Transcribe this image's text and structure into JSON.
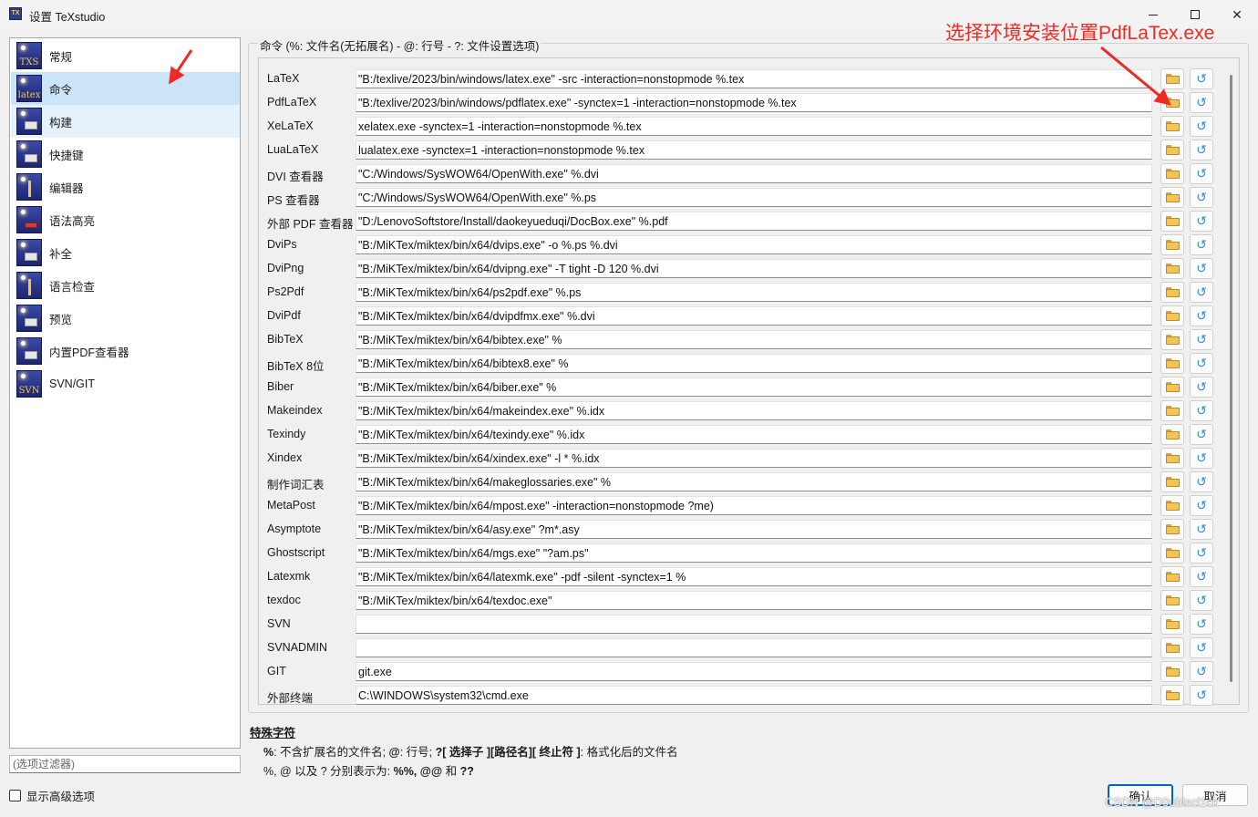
{
  "window": {
    "title": "设置 TeXstudio",
    "icon": "texstudio-app-icon"
  },
  "nav": {
    "items": [
      {
        "id": "general",
        "label": "常规",
        "icon": "txs-icon",
        "glyph": "TXS",
        "state": ""
      },
      {
        "id": "commands",
        "label": "命令",
        "icon": "latex-icon",
        "glyph": "latex",
        "state": "selected"
      },
      {
        "id": "build",
        "label": "构建",
        "icon": "build-icon",
        "glyph": "",
        "state": "hovered"
      },
      {
        "id": "shortcuts",
        "label": "快捷键",
        "icon": "keyboard-icon",
        "glyph": "",
        "state": ""
      },
      {
        "id": "editor",
        "label": "编辑器",
        "icon": "cursor-icon",
        "glyph": "",
        "state": ""
      },
      {
        "id": "syntax",
        "label": "语法高亮",
        "icon": "highlight-icon",
        "glyph": "",
        "state": ""
      },
      {
        "id": "completion",
        "label": "补全",
        "icon": "completion-icon",
        "glyph": "",
        "state": ""
      },
      {
        "id": "spell",
        "label": "语言检查",
        "icon": "spellcheck-icon",
        "glyph": "",
        "state": ""
      },
      {
        "id": "preview",
        "label": "预览",
        "icon": "preview-icon",
        "glyph": "",
        "state": ""
      },
      {
        "id": "pdfviewer",
        "label": "内置PDF查看器",
        "icon": "pdf-viewer-icon",
        "glyph": "",
        "state": ""
      },
      {
        "id": "svn",
        "label": "SVN/GIT",
        "icon": "svn-icon",
        "glyph": "SVN",
        "state": ""
      }
    ],
    "filter_placeholder": "(选项过滤器)",
    "advanced_label": "显示高级选项",
    "advanced_checked": false
  },
  "commands": {
    "group_title": "命令 (%: 文件名(无拓展名) - @: 行号 - ?: 文件设置选项)",
    "rows": [
      {
        "label": "LaTeX",
        "value": "\"B:/texlive/2023/bin/windows/latex.exe\" -src -interaction=nonstopmode %.tex"
      },
      {
        "label": "PdfLaTeX",
        "value": "\"B:/texlive/2023/bin/windows/pdflatex.exe\" -synctex=1 -interaction=nonstopmode %.tex"
      },
      {
        "label": "XeLaTeX",
        "value": "xelatex.exe -synctex=1 -interaction=nonstopmode %.tex"
      },
      {
        "label": "LuaLaTeX",
        "value": "lualatex.exe -synctex=1 -interaction=nonstopmode %.tex"
      },
      {
        "label": "DVI 查看器",
        "value": "\"C:/Windows/SysWOW64/OpenWith.exe\" %.dvi"
      },
      {
        "label": "PS 查看器",
        "value": "\"C:/Windows/SysWOW64/OpenWith.exe\" %.ps"
      },
      {
        "label": "外部 PDF 查看器",
        "value": "\"D:/LenovoSoftstore/Install/daokeyueduqi/DocBox.exe\" %.pdf"
      },
      {
        "label": "DviPs",
        "value": "\"B:/MiKTex/miktex/bin/x64/dvips.exe\" -o %.ps %.dvi"
      },
      {
        "label": "DviPng",
        "value": "\"B:/MiKTex/miktex/bin/x64/dvipng.exe\" -T tight -D 120 %.dvi"
      },
      {
        "label": "Ps2Pdf",
        "value": "\"B:/MiKTex/miktex/bin/x64/ps2pdf.exe\" %.ps"
      },
      {
        "label": "DviPdf",
        "value": "\"B:/MiKTex/miktex/bin/x64/dvipdfmx.exe\" %.dvi"
      },
      {
        "label": "BibTeX",
        "value": "\"B:/MiKTex/miktex/bin/x64/bibtex.exe\" %"
      },
      {
        "label": "BibTeX 8位",
        "value": "\"B:/MiKTex/miktex/bin/x64/bibtex8.exe\" %"
      },
      {
        "label": "Biber",
        "value": "\"B:/MiKTex/miktex/bin/x64/biber.exe\" %"
      },
      {
        "label": "Makeindex",
        "value": "\"B:/MiKTex/miktex/bin/x64/makeindex.exe\" %.idx"
      },
      {
        "label": "Texindy",
        "value": "\"B:/MiKTex/miktex/bin/x64/texindy.exe\" %.idx"
      },
      {
        "label": "Xindex",
        "value": "\"B:/MiKTex/miktex/bin/x64/xindex.exe\" -l * %.idx"
      },
      {
        "label": "制作词汇表",
        "value": "\"B:/MiKTex/miktex/bin/x64/makeglossaries.exe\" %"
      },
      {
        "label": "MetaPost",
        "value": "\"B:/MiKTex/miktex/bin/x64/mpost.exe\" -interaction=nonstopmode ?me)"
      },
      {
        "label": "Asymptote",
        "value": "\"B:/MiKTex/miktex/bin/x64/asy.exe\" ?m*.asy"
      },
      {
        "label": "Ghostscript",
        "value": "\"B:/MiKTex/miktex/bin/x64/mgs.exe\" \"?am.ps\""
      },
      {
        "label": "Latexmk",
        "value": "\"B:/MiKTex/miktex/bin/x64/latexmk.exe\" -pdf -silent -synctex=1 %"
      },
      {
        "label": "texdoc",
        "value": "\"B:/MiKTex/miktex/bin/x64/texdoc.exe\""
      },
      {
        "label": "SVN",
        "value": ""
      },
      {
        "label": "SVNADMIN",
        "value": ""
      },
      {
        "label": "GIT",
        "value": "git.exe"
      },
      {
        "label": "外部终端",
        "value": "C:\\WINDOWS\\system32\\cmd.exe"
      }
    ],
    "folder_icon": "folder-icon",
    "reset_icon": "reset-icon",
    "reset_glyph": "↺"
  },
  "special": {
    "title": "特殊字符",
    "line1": {
      "p1b": "%",
      "p1": ": 不含扩展名的文件名;  ",
      "p2b": "@",
      "p2": ": 行号;  ",
      "p3b": "?[ 选择子 ][路径名][ 终止符 ]",
      "p3": ": 格式化后的文件名"
    },
    "line2": {
      "p1": "%, @ 以及 ? 分别表示为: ",
      "p2b": "%%, @@",
      "p3": " 和 ",
      "p4b": "??"
    }
  },
  "buttons": {
    "ok": "确认",
    "cancel": "取消"
  },
  "annotation": {
    "text": "选择环境安装位置PdfLaTex.exe",
    "color": "#ee2a24"
  },
  "watermark": "CSDN @D0ublecl1ck"
}
